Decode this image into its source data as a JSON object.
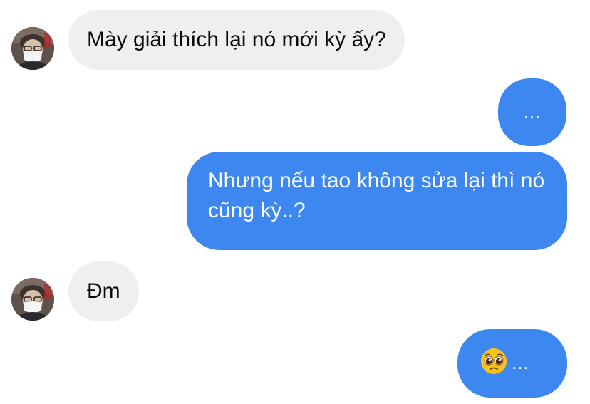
{
  "messages": [
    {
      "sender": "other",
      "text": "Mày giải thích lại nó mới kỳ ấy?"
    },
    {
      "sender": "me",
      "text": "..."
    },
    {
      "sender": "me",
      "text": "Nhưng nếu tao không sửa lại thì nó cũng kỳ..?"
    },
    {
      "sender": "other",
      "text": "Đm"
    },
    {
      "sender": "me",
      "emoji": "pleading-face-icon",
      "text": "..."
    }
  ],
  "colors": {
    "incoming_bubble": "#efefef",
    "outgoing_bubble": "#3c87f0"
  }
}
